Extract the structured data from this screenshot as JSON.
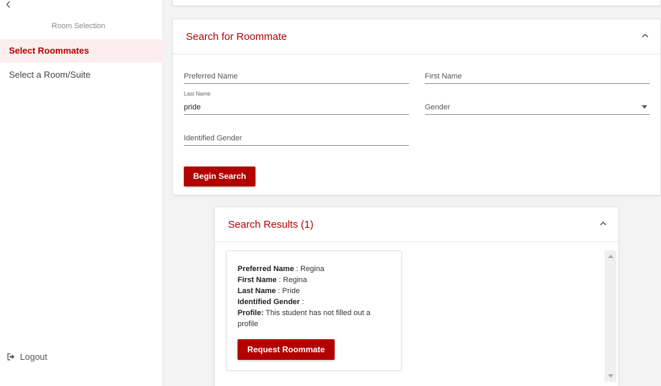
{
  "sidebar": {
    "back_icon": "chevron-left-icon",
    "heading": "Room Selection",
    "items": [
      {
        "label": "Select Roommates",
        "active": true
      },
      {
        "label": "Select a Room/Suite",
        "active": false
      }
    ],
    "logout_label": "Logout",
    "logout_icon": "sign-out-icon"
  },
  "search": {
    "title": "Search for Roommate",
    "fields": {
      "preferred_name": {
        "placeholder": "Preferred Name",
        "value": ""
      },
      "first_name": {
        "placeholder": "First Name",
        "value": ""
      },
      "last_name": {
        "label": "Last Name",
        "value": "pride"
      },
      "gender": {
        "placeholder": "Gender",
        "value": ""
      },
      "identified_gender": {
        "placeholder": "Identified Gender",
        "value": ""
      }
    },
    "button_label": "Begin Search"
  },
  "results": {
    "title": "Search Results (1)",
    "items": [
      {
        "preferred_name_label": "Preferred Name",
        "preferred_name": " : Regina",
        "first_name_label": "First Name",
        "first_name": " : Regina",
        "last_name_label": "Last Name",
        "last_name": " : Pride",
        "identified_gender_label": "Identified Gender",
        "identified_gender": " :",
        "profile_label": "Profile:",
        "profile": " This student has not filled out a profile",
        "button_label": "Request Roommate"
      }
    ]
  },
  "colors": {
    "accent": "#b30000",
    "active_bg": "#fbeeee",
    "page_bg": "#f3f3f3"
  }
}
